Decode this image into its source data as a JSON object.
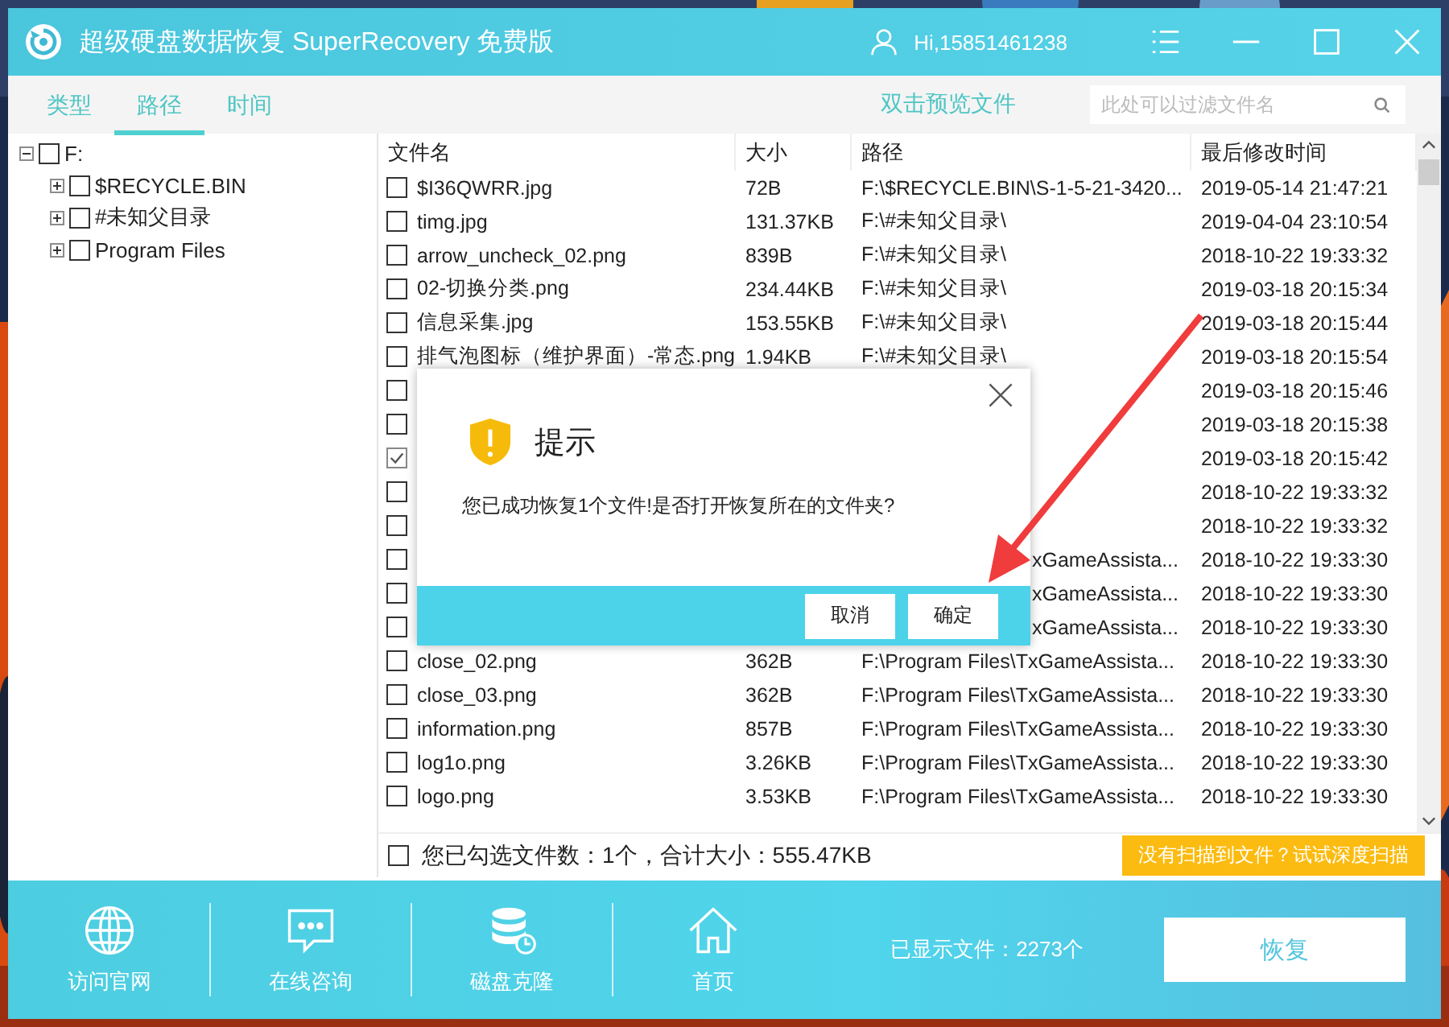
{
  "window": {
    "title": "超级硬盘数据恢复 SuperRecovery 免费版",
    "user": "Hi,15851461238"
  },
  "tabs": [
    {
      "label": "类型",
      "selected": false
    },
    {
      "label": "路径",
      "selected": true
    },
    {
      "label": "时间",
      "selected": false
    }
  ],
  "preview_hint": "双击预览文件",
  "filter": {
    "placeholder": "此处可以过滤文件名"
  },
  "tree": {
    "label": "F:",
    "expanded": true,
    "checked": false,
    "children": [
      {
        "label": "$RECYCLE.BIN",
        "expanded": false,
        "checked": false
      },
      {
        "label": "#未知父目录",
        "expanded": false,
        "checked": false
      },
      {
        "label": "Program Files",
        "expanded": false,
        "checked": false
      }
    ]
  },
  "table": {
    "columns": [
      "文件名",
      "大小",
      "路径",
      "最后修改时间"
    ],
    "rows": [
      {
        "checked": false,
        "name": "$I36QWRR.jpg",
        "size": "72B",
        "path": "F:\\$RECYCLE.BIN\\S-1-5-21-3420...",
        "time": "2019-05-14 21:47:21"
      },
      {
        "checked": false,
        "name": "timg.jpg",
        "size": "131.37KB",
        "path": "F:\\#未知父目录\\",
        "time": "2019-04-04 23:10:54"
      },
      {
        "checked": false,
        "name": "arrow_uncheck_02.png",
        "size": "839B",
        "path": "F:\\#未知父目录\\",
        "time": "2018-10-22 19:33:32"
      },
      {
        "checked": false,
        "name": "02-切换分类.png",
        "size": "234.44KB",
        "path": "F:\\#未知父目录\\",
        "time": "2019-03-18 20:15:34"
      },
      {
        "checked": false,
        "name": "信息采集.jpg",
        "size": "153.55KB",
        "path": "F:\\#未知父目录\\",
        "time": "2019-03-18 20:15:44"
      },
      {
        "checked": false,
        "name": "排气泡图标（维护界面）-常态.png",
        "size": "1.94KB",
        "path": "F:\\#未知父目录\\",
        "time": "2019-03-18 20:15:54"
      },
      {
        "checked": false,
        "covered": true,
        "time": "2019-03-18 20:15:46"
      },
      {
        "checked": false,
        "covered": true,
        "time": "2019-03-18 20:15:38"
      },
      {
        "checked": true,
        "covered": true,
        "time": "2019-03-18 20:15:42"
      },
      {
        "checked": false,
        "covered": true,
        "time": "2018-10-22 19:33:32"
      },
      {
        "checked": false,
        "covered": true,
        "time": "2018-10-22 19:33:32"
      },
      {
        "checked": false,
        "covered": true,
        "path": "xGameAssista...",
        "time": "2018-10-22 19:33:30"
      },
      {
        "checked": false,
        "covered": true,
        "path": "xGameAssista...",
        "time": "2018-10-22 19:33:30"
      },
      {
        "checked": false,
        "covered": true,
        "path": "xGameAssista...",
        "time": "2018-10-22 19:33:30"
      },
      {
        "checked": false,
        "name": "close_02.png",
        "size": "362B",
        "path": "F:\\Program Files\\TxGameAssista...",
        "time": "2018-10-22 19:33:30"
      },
      {
        "checked": false,
        "name": "close_03.png",
        "size": "362B",
        "path": "F:\\Program Files\\TxGameAssista...",
        "time": "2018-10-22 19:33:30"
      },
      {
        "checked": false,
        "name": "information.png",
        "size": "857B",
        "path": "F:\\Program Files\\TxGameAssista...",
        "time": "2018-10-22 19:33:30"
      },
      {
        "checked": false,
        "name": "log1o.png",
        "size": "3.26KB",
        "path": "F:\\Program Files\\TxGameAssista...",
        "time": "2018-10-22 19:33:30"
      },
      {
        "checked": false,
        "name": "logo.png",
        "size": "3.53KB",
        "path": "F:\\Program Files\\TxGameAssista...",
        "time": "2018-10-22 19:33:30"
      }
    ]
  },
  "selection_summary": {
    "checked": false,
    "text": "您已勾选文件数：1个，合计大小：555.47KB"
  },
  "deep_scan_button": "没有扫描到文件？试试深度扫描",
  "toolbar": [
    {
      "label": "访问官网",
      "kind": "globe"
    },
    {
      "label": "在线咨询",
      "kind": "chat"
    },
    {
      "label": "磁盘克隆",
      "kind": "disk"
    },
    {
      "label": "首页",
      "kind": "home"
    }
  ],
  "file_count": "已显示文件：2273个",
  "recover_button": "恢复",
  "dialog": {
    "title": "提示",
    "message": "您已成功恢复1个文件!是否打开恢复所在的文件夹?",
    "buttons": [
      "取消",
      "确定"
    ]
  }
}
